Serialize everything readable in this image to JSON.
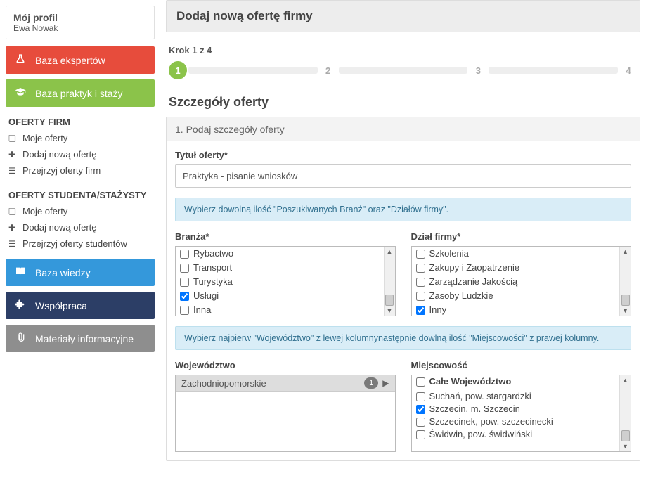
{
  "profile": {
    "title": "Mój profil",
    "user": "Ewa Nowak"
  },
  "sidebar": {
    "primary": [
      {
        "label": "Baza ekspertów"
      },
      {
        "label": "Baza praktyk i staży"
      }
    ],
    "group_firm_title": "OFERTY FIRM",
    "group_firm": [
      {
        "label": "Moje oferty"
      },
      {
        "label": "Dodaj nową ofertę"
      },
      {
        "label": "Przejrzyj oferty firm"
      }
    ],
    "group_student_title": "OFERTY STUDENTA/STAŻYSTY",
    "group_student": [
      {
        "label": "Moje oferty"
      },
      {
        "label": "Dodaj nową ofertę"
      },
      {
        "label": "Przejrzyj oferty studentów"
      }
    ],
    "secondary": [
      {
        "label": "Baza wiedzy"
      },
      {
        "label": "Współpraca"
      },
      {
        "label": "Materiały informacyjne"
      }
    ]
  },
  "page": {
    "title": "Dodaj nową ofertę firmy",
    "step_label": "Krok 1 z 4",
    "steps": [
      "1",
      "2",
      "3",
      "4"
    ],
    "section_title": "Szczegóły oferty",
    "panel_title": "1. Podaj szczegóły oferty",
    "field_title_label": "Tytuł oferty*",
    "field_title_value": "Praktyka - pisanie wniosków",
    "info1": "Wybierz dowolną ilość \"Poszukiwanych Branż\" oraz \"Działów firmy\".",
    "branch_label": "Branża*",
    "branches": [
      {
        "label": "Rybactwo",
        "checked": false
      },
      {
        "label": "Transport",
        "checked": false
      },
      {
        "label": "Turystyka",
        "checked": false
      },
      {
        "label": "Usługi",
        "checked": true
      },
      {
        "label": "Inna",
        "checked": false
      }
    ],
    "dept_label": "Dział firmy*",
    "depts": [
      {
        "label": "Szkolenia",
        "checked": false
      },
      {
        "label": "Zakupy i Zaopatrzenie",
        "checked": false
      },
      {
        "label": "Zarządzanie Jakością",
        "checked": false
      },
      {
        "label": "Zasoby Ludzkie",
        "checked": false
      },
      {
        "label": "Inny",
        "checked": true
      }
    ],
    "info2": "Wybierz najpierw \"Województwo\" z lewej kolumnynastępnie dowlną ilość \"Miejscowości\" z prawej kolumny.",
    "woj_label": "Województwo",
    "woj_selected": "Zachodniopomorskie",
    "woj_count": "1",
    "loc_label": "Miejscowość",
    "locs": [
      {
        "label": "Całe Województwo",
        "checked": false,
        "header": true
      },
      {
        "label": "Suchań, pow. stargardzki",
        "checked": false
      },
      {
        "label": "Szczecin, m. Szczecin",
        "checked": true
      },
      {
        "label": "Szczecinek, pow. szczecinecki",
        "checked": false
      },
      {
        "label": "Świdwin, pow. świdwiński",
        "checked": false
      }
    ]
  }
}
